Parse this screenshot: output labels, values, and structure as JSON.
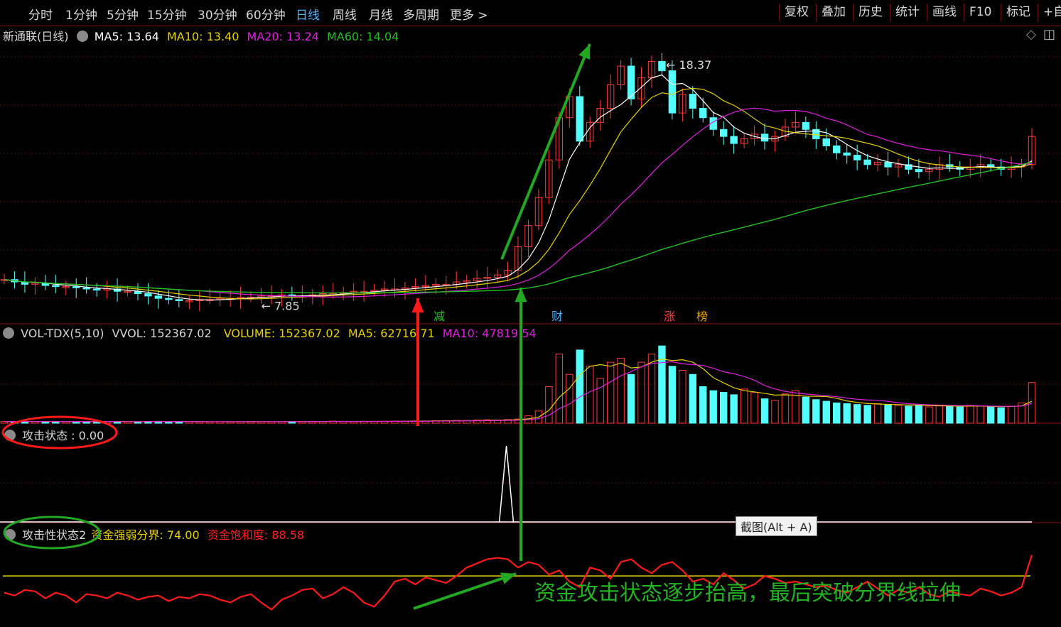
{
  "toolbar": {
    "periods": [
      "分时",
      "1分钟",
      "5分钟",
      "15分钟",
      "30分钟",
      "60分钟",
      "日线",
      "周线",
      "月线",
      "多周期",
      "更多 >"
    ],
    "active_period": "日线",
    "right_buttons": [
      "复权",
      "叠加",
      "历史",
      "统计",
      "画线",
      "F10",
      "标记",
      "+自"
    ]
  },
  "main_panel": {
    "stock_title": "新通联(日线)",
    "ma5_label": "MA5: 13.64",
    "ma10_label": "MA10: 13.40",
    "ma20_label": "MA20: 13.24",
    "ma60_label": "MA60: 14.04",
    "high_label": "18.37",
    "low_label": "7.85",
    "event_marks": [
      "减",
      "财",
      "涨",
      "榜"
    ],
    "colors": {
      "ma5": "#ffffff",
      "ma10": "#e6d200",
      "ma20": "#e020e0",
      "ma60": "#22c022",
      "up": "#ff3c3c",
      "down": "#54ffff"
    }
  },
  "volume_panel": {
    "name_label": "VOL-TDX(5,10)",
    "vvol_label": "VVOL: 152367.02",
    "volume_label": "VOLUME: 152367.02",
    "ma5_label": "MA5: 62716.71",
    "ma10_label": "MA10: 47819.54"
  },
  "attack_panel": {
    "name_label": "攻击状态 : 0.00"
  },
  "fund_panel": {
    "name_label": "攻击性状态2",
    "boundary_label": "资金强弱分界: 74.00",
    "saturation_label": "资金饱和度: 88.58"
  },
  "annotation": "资金攻击状态逐步抬高，最后突破分界线拉伸",
  "tooltip": "截图(Alt + A)",
  "chart_data": {
    "type": "candlestick",
    "price_range": [
      7.5,
      19.0
    ],
    "high_point": 18.37,
    "low_point": 7.85,
    "close": [
      8.9,
      8.8,
      8.7,
      8.75,
      8.65,
      8.6,
      8.6,
      8.55,
      8.5,
      8.45,
      8.5,
      8.4,
      8.4,
      8.3,
      8.2,
      8.1,
      8.05,
      8.0,
      8.0,
      8.05,
      8.05,
      8.1,
      8.1,
      8.15,
      8.15,
      8.2,
      8.2,
      8.25,
      8.2,
      8.2,
      8.25,
      8.3,
      8.3,
      8.35,
      8.4,
      8.4,
      8.45,
      8.5,
      8.5,
      8.55,
      8.6,
      8.65,
      8.7,
      8.7,
      8.8,
      8.85,
      8.95,
      9.0,
      9.1,
      9.3,
      10.3,
      11.2,
      12.4,
      14.0,
      15.8,
      16.7,
      14.8,
      15.6,
      16.2,
      17.2,
      18.0,
      16.6,
      17.5,
      18.2,
      17.8,
      16.0,
      16.8,
      16.2,
      15.8,
      15.3,
      15.0,
      14.7,
      14.9,
      15.1,
      14.8,
      15.0,
      15.4,
      15.6,
      15.3,
      14.9,
      14.6,
      14.3,
      14.2,
      14.0,
      13.8,
      13.9,
      13.7,
      13.8,
      13.6,
      13.5,
      13.6,
      13.8,
      13.7,
      13.6,
      13.7,
      13.8,
      13.7,
      13.6,
      13.7,
      13.8,
      15.0
    ],
    "volume_scale_max": 110000,
    "volume": [
      2000,
      2200,
      1800,
      2100,
      1900,
      2000,
      1700,
      1800,
      1900,
      2200,
      2000,
      1800,
      1900,
      1700,
      2100,
      2300,
      1900,
      2000,
      1800,
      1700,
      1600,
      1800,
      1900,
      2000,
      2100,
      1700,
      1800,
      1900,
      2000,
      2200,
      2300,
      2100,
      2500,
      2000,
      2100,
      2300,
      2200,
      2400,
      2600,
      2500,
      2800,
      2700,
      3000,
      3200,
      3400,
      3300,
      3800,
      4200,
      4000,
      4500,
      5000,
      9000,
      15000,
      45000,
      85000,
      60000,
      90000,
      70000,
      55000,
      75000,
      80000,
      60000,
      75000,
      85000,
      95000,
      70000,
      65000,
      60000,
      45000,
      40000,
      38000,
      35000,
      42000,
      38000,
      30000,
      28000,
      36000,
      40000,
      32000,
      29000,
      27000,
      25000,
      24000,
      23000,
      22000,
      24000,
      23000,
      22000,
      21000,
      22000,
      20000,
      22000,
      21000,
      20000,
      22000,
      21000,
      20000,
      19000,
      21000,
      25000,
      50000
    ],
    "attack_state": {
      "spike_value": 1,
      "current": 0.0
    },
    "fund_saturation": {
      "boundary": 74.0,
      "current": 88.58,
      "range": [
        40,
        100
      ],
      "values": [
        62,
        60,
        64,
        63,
        58,
        62,
        60,
        55,
        61,
        60,
        58,
        62,
        60,
        57,
        59,
        60,
        56,
        59,
        58,
        61,
        60,
        57,
        55,
        59,
        61,
        55,
        50,
        57,
        60,
        64,
        65,
        58,
        61,
        66,
        62,
        55,
        52,
        60,
        70,
        72,
        68,
        73,
        71,
        69,
        74,
        80,
        83,
        86,
        87,
        86,
        80,
        84,
        82,
        75,
        78,
        70,
        66,
        80,
        78,
        72,
        84,
        86,
        80,
        76,
        82,
        84,
        78,
        70,
        72,
        68,
        76,
        71,
        65,
        68,
        74,
        72,
        69,
        70,
        68,
        66,
        67,
        64,
        62,
        66,
        70,
        65,
        60,
        64,
        62,
        66,
        61,
        59,
        63,
        61,
        60,
        65,
        63,
        60,
        62,
        66,
        89
      ]
    }
  }
}
